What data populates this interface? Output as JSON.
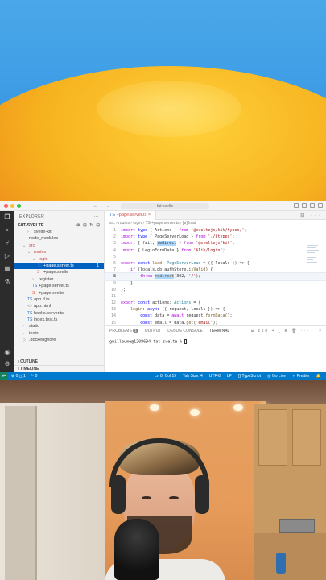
{
  "window": {
    "search_placeholder": "fat-svelte",
    "nav_arrows": "← →"
  },
  "activity_icons": [
    "files-icon",
    "search-icon",
    "source-control-icon",
    "run-debug-icon",
    "extensions-icon",
    "testing-icon"
  ],
  "sidebar": {
    "header": "EXPLORER",
    "project": "FAT-SVELTE",
    "items": [
      {
        "label": "svelte-kit",
        "indent": 2,
        "icon": "›",
        "kind": "folder"
      },
      {
        "label": "node_modules",
        "indent": 1,
        "icon": "›",
        "kind": "folder"
      },
      {
        "label": "src",
        "indent": 1,
        "icon": "⌄",
        "kind": "folder",
        "red": true
      },
      {
        "label": "routes",
        "indent": 2,
        "icon": "⌄",
        "kind": "folder",
        "red": true
      },
      {
        "label": "login",
        "indent": 3,
        "icon": "⌄",
        "kind": "folder",
        "red": true
      },
      {
        "label": "+page.server.ts",
        "indent": 4,
        "icon": "TS",
        "kind": "ts",
        "selected": true,
        "badge": "1"
      },
      {
        "label": "+page.svelte",
        "indent": 4,
        "icon": "S",
        "kind": "svelte"
      },
      {
        "label": "register",
        "indent": 3,
        "icon": "›",
        "kind": "folder"
      },
      {
        "label": "+page.server.ts",
        "indent": 3,
        "icon": "TS",
        "kind": "ts"
      },
      {
        "label": "+page.svelte",
        "indent": 3,
        "icon": "S",
        "kind": "svelte"
      },
      {
        "label": "app.d.ts",
        "indent": 2,
        "icon": "TS",
        "kind": "ts"
      },
      {
        "label": "app.html",
        "indent": 2,
        "icon": "<>",
        "kind": "file"
      },
      {
        "label": "hooks.server.ts",
        "indent": 2,
        "icon": "TS",
        "kind": "ts"
      },
      {
        "label": "index.test.ts",
        "indent": 2,
        "icon": "TS",
        "kind": "ts"
      },
      {
        "label": "static",
        "indent": 1,
        "icon": "›",
        "kind": "folder"
      },
      {
        "label": "tests",
        "indent": 1,
        "icon": "›",
        "kind": "folder"
      },
      {
        "label": ".dockerignore",
        "indent": 1,
        "icon": "◇",
        "kind": "file"
      }
    ],
    "outline": "OUTLINE",
    "timeline": "TIMELINE"
  },
  "editor": {
    "tab": "+page.server.ts",
    "breadcrumb": "src › routes › login › TS +page.server.ts › [ø] load",
    "lines": [
      "1",
      "2",
      "3",
      "4",
      "5",
      "6",
      "7",
      "8",
      "9",
      "10",
      "11",
      "12",
      "13",
      "14",
      "15"
    ]
  },
  "panel": {
    "tabs": [
      "PROBLEMS",
      "OUTPUT",
      "DEBUG CONSOLE",
      "TERMINAL"
    ],
    "problems_count": "1",
    "shell": "zsh",
    "prompt": "guillaume@1208694 fat-svelte %"
  },
  "statusbar": {
    "left": [
      "⊗ 0 △ 1",
      "⚐ 0"
    ],
    "right": [
      "Ln 8, Col 19",
      "Tab Size: 4",
      "UTF-8",
      "LF",
      "{} TypeScript",
      "◎ Go Live",
      "✓ Prettier"
    ]
  }
}
